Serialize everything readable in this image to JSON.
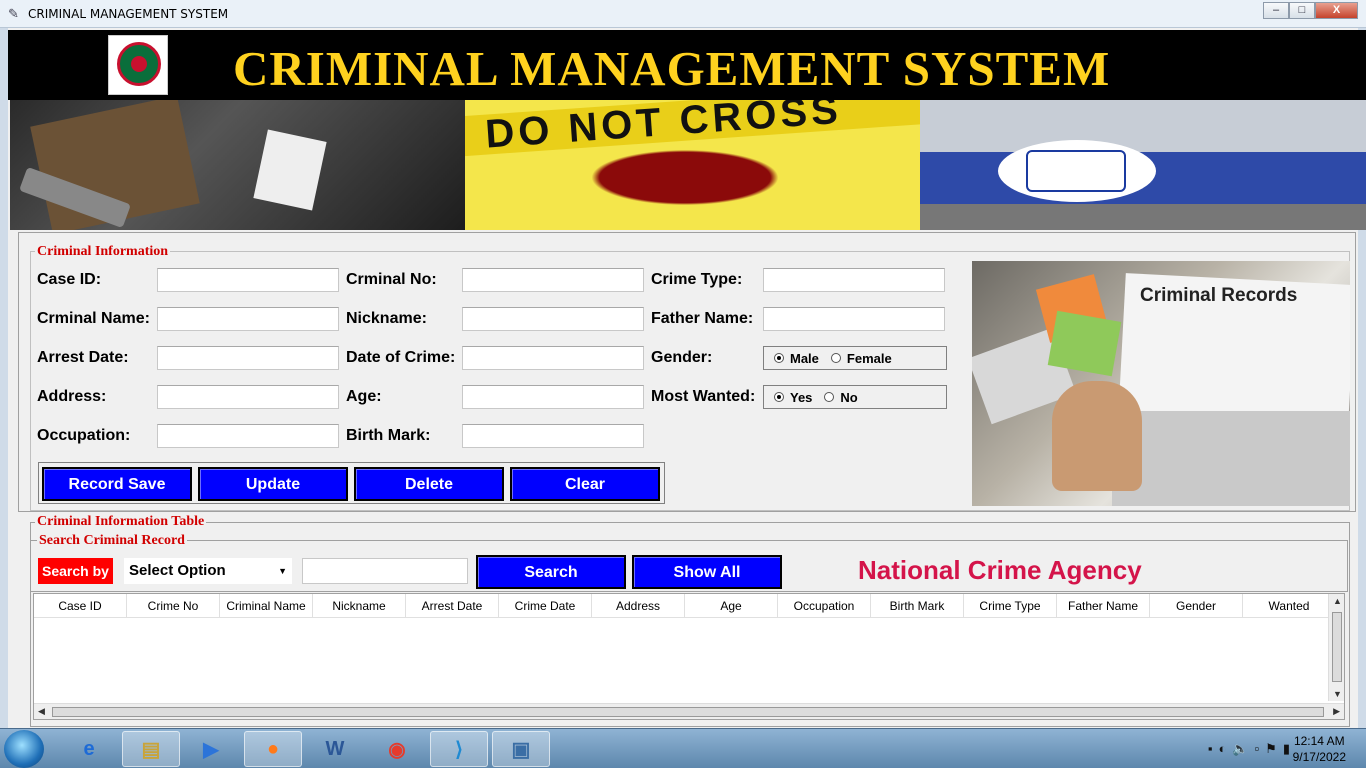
{
  "window": {
    "title": "CRIMINAL MANAGEMENT SYSTEM",
    "minimize": "–",
    "maximize": "□",
    "close": "X"
  },
  "header": {
    "title": "CRIMINAL MANAGEMENT SYSTEM",
    "banner_tape_text": "DO NOT CROSS",
    "records_image_text": "Criminal Records"
  },
  "criminal_info": {
    "legend": "Criminal Information",
    "labels": {
      "case_id": "Case ID:",
      "criminal_no": "Crminal No:",
      "crime_type": "Crime Type:",
      "criminal_name": "Crminal Name:",
      "nickname": "Nickname:",
      "father_name": "Father Name:",
      "arrest_date": "Arrest Date:",
      "date_of_crime": "Date of Crime:",
      "gender": "Gender:",
      "address": "Address:",
      "age": "Age:",
      "most_wanted": "Most Wanted:",
      "occupation": "Occupation:",
      "birth_mark": "Birth Mark:"
    },
    "gender_options": [
      "Male",
      "Female"
    ],
    "gender_selected": "Male",
    "wanted_options": [
      "Yes",
      "No"
    ],
    "wanted_selected": "Yes",
    "buttons": {
      "save": "Record Save",
      "update": "Update",
      "delete": "Delete",
      "clear": "Clear"
    }
  },
  "table_section": {
    "legend": "Criminal Information Table",
    "search_legend": "Search Criminal Record",
    "search_by": "Search by",
    "select_value": "Select Option",
    "search_button": "Search",
    "show_all_button": "Show All",
    "agency": "National Crime Agency",
    "columns": [
      "Case ID",
      "Crime No",
      "Criminal Name",
      "Nickname",
      "Arrest Date",
      "Crime Date",
      "Address",
      "Age",
      "Occupation",
      "Birth Mark",
      "Crime Type",
      "Father Name",
      "Gender",
      "Wanted"
    ],
    "rows": []
  },
  "taskbar": {
    "time": "12:14 AM",
    "date": "9/17/2022"
  },
  "colors": {
    "header_bg": "#000000",
    "title_yellow": "#ffd21f",
    "legend_red": "#d10000",
    "button_blue": "#0000ff",
    "agency_red": "#d4144a",
    "search_by_red": "#ff0000"
  }
}
